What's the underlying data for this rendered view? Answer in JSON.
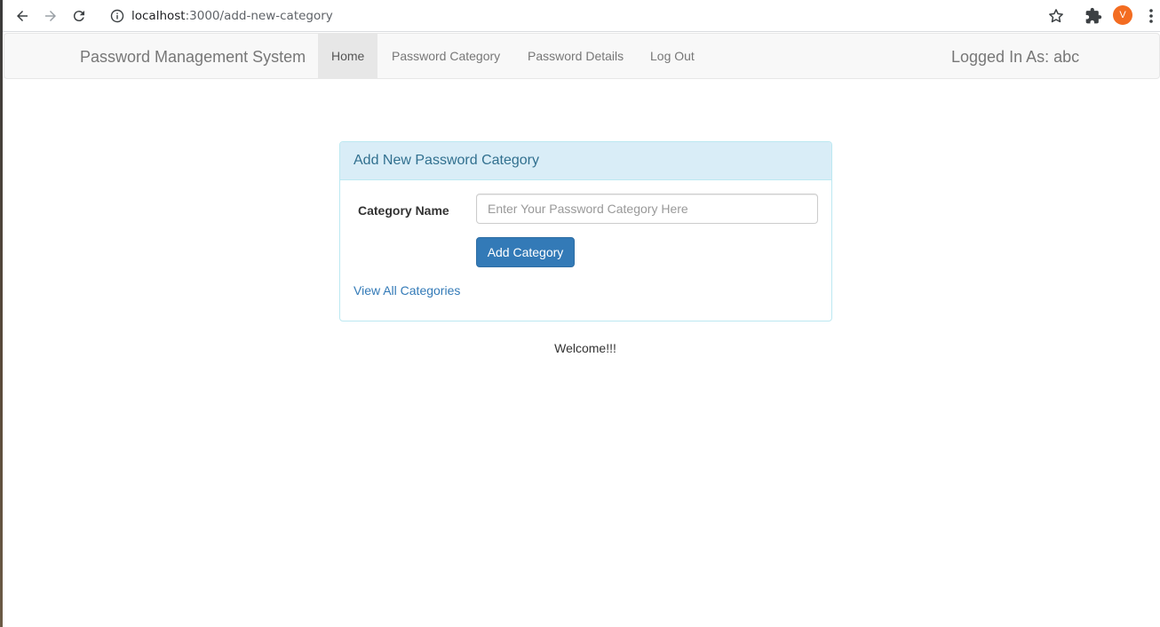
{
  "browser": {
    "url_host": "localhost",
    "url_path": ":3000/add-new-category",
    "profile_initial": "V"
  },
  "navbar": {
    "brand": "Password Management System",
    "items": [
      {
        "label": "Home",
        "active": true
      },
      {
        "label": "Password Category",
        "active": false
      },
      {
        "label": "Password Details",
        "active": false
      },
      {
        "label": "Log Out",
        "active": false
      }
    ],
    "logged_in": "Logged In As: abc"
  },
  "panel": {
    "heading": "Add New Password Category",
    "field_label": "Category Name",
    "input_placeholder": "Enter Your Password Category Here",
    "input_value": "",
    "button_label": "Add Category",
    "link_label": "View All Categories"
  },
  "footer": {
    "welcome": "Welcome!!!"
  },
  "colors": {
    "accent": "#337ab7",
    "panel_heading_bg": "#d9edf7",
    "panel_heading_text": "#31708f",
    "profile": "#f36c21"
  }
}
